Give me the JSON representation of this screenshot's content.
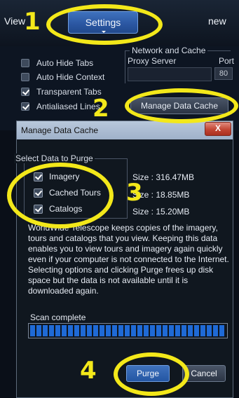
{
  "menu": {
    "view_label": "View",
    "settings_label": "Settings",
    "new_label": "new"
  },
  "settings_panel": {
    "options": [
      {
        "label": "Auto Hide Tabs",
        "checked": false
      },
      {
        "label": "Auto Hide Context",
        "checked": false
      },
      {
        "label": "Transparent Tabs",
        "checked": true
      },
      {
        "label": "Antialiased Lines",
        "checked": true
      }
    ],
    "network_group_title": "Network and Cache",
    "proxy_label": "Proxy Server",
    "port_label": "Port",
    "port_value": "80",
    "manage_cache_button": "Manage Data Cache"
  },
  "dialog": {
    "title": "Manage Data Cache",
    "close_label": "X",
    "select_title": "Select Data to Purge",
    "items": [
      {
        "label": "Imagery",
        "checked": true,
        "size": "Size : 316.47MB"
      },
      {
        "label": "Cached Tours",
        "checked": true,
        "size": "Size : 18.85MB"
      },
      {
        "label": "Catalogs",
        "checked": true,
        "size": "Size : 15.20MB"
      }
    ],
    "description": "WorldWide Telescope keeps copies of the imagery, tours and catalogs that you view. Keeping this data enables you to view tours and imagery again quickly even if your computer is not connected to the Internet. Selecting options and clicking Purge frees up disk space but the data is not available until it is downloaded again.",
    "scan_status": "Scan complete",
    "progress": 1.0,
    "purge_button": "Purge",
    "cancel_button": "Cancel"
  },
  "annotations": {
    "step_1": "1",
    "step_2": "2",
    "step_3": "3",
    "step_4": "4",
    "highlight_color": "#f3e81a"
  }
}
